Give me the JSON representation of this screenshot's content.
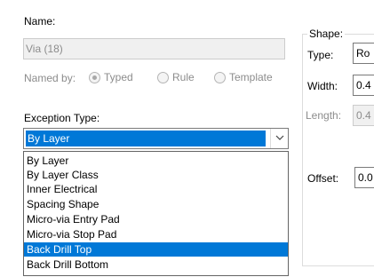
{
  "name_label": "Name:",
  "name_value": "Via (18)",
  "named_by": {
    "label": "Named by:",
    "options": [
      {
        "label": "Typed",
        "checked": true
      },
      {
        "label": "Rule",
        "checked": false
      },
      {
        "label": "Template",
        "checked": false
      }
    ]
  },
  "exception_type": {
    "label": "Exception Type:",
    "selected": "By Layer",
    "options": [
      "By Layer",
      "By Layer Class",
      "Inner Electrical",
      "Spacing Shape",
      "Micro-via Entry Pad",
      "Micro-via Stop Pad",
      "Back Drill Top",
      "Back Drill Bottom"
    ],
    "highlighted_index": 6
  },
  "shape": {
    "group_label": "Shape:",
    "type_label": "Type:",
    "type_value": "Ro",
    "width_label": "Width:",
    "width_value": "0.4",
    "length_label": "Length:",
    "length_value": "0.4",
    "offset_label": "Offset:",
    "offset_value": "0.0"
  },
  "icons": {
    "combo_arrow": "chevron-down-icon"
  }
}
